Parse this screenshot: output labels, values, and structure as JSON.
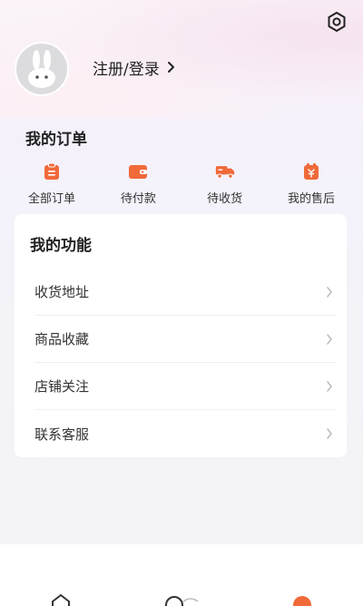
{
  "header": {
    "settings_icon": "gear-icon",
    "avatar_icon": "rabbit-avatar-icon",
    "login_label": "注册/登录"
  },
  "orders": {
    "title": "我的订单",
    "accent_color": "#f06a3a",
    "items": [
      {
        "label": "全部订单",
        "icon": "clipboard-icon"
      },
      {
        "label": "待付款",
        "icon": "wallet-icon"
      },
      {
        "label": "待收货",
        "icon": "truck-icon"
      },
      {
        "label": "我的售后",
        "icon": "after-sale-icon"
      }
    ]
  },
  "functions": {
    "title": "我的功能",
    "items": [
      {
        "label": "收货地址"
      },
      {
        "label": "商品收藏"
      },
      {
        "label": "店铺关注"
      },
      {
        "label": "联系客服"
      }
    ]
  },
  "tabbar": {
    "tabs": [
      {
        "icon": "home-icon"
      },
      {
        "icon": "category-icon"
      },
      {
        "icon": "profile-icon"
      }
    ]
  }
}
